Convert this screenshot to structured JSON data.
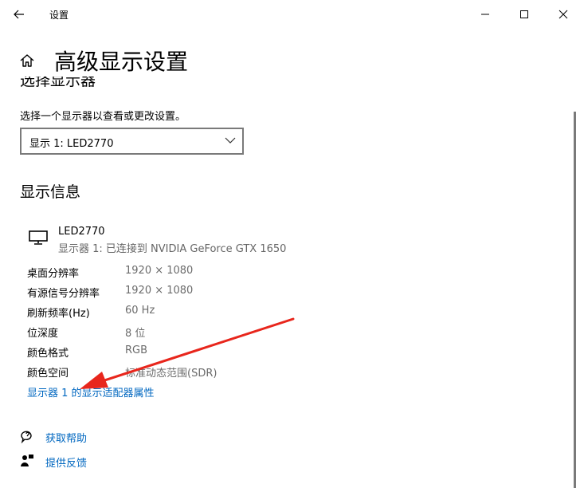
{
  "window": {
    "title": "设置",
    "controls": [
      "minimize-icon",
      "maximize-icon",
      "close-icon"
    ]
  },
  "page": {
    "title": "高级显示设置",
    "partial_heading": "选择显示器",
    "choose_text": "选择一个显示器以查看或更改设置。",
    "display_select": {
      "value": "显示 1: LED2770"
    }
  },
  "display_info": {
    "heading": "显示信息",
    "monitor_name": "LED2770",
    "monitor_sub": "显示器 1: 已连接到 NVIDIA GeForce GTX 1650",
    "rows": [
      {
        "label": "桌面分辨率",
        "value": "1920 × 1080"
      },
      {
        "label": "有源信号分辨率",
        "value": "1920 × 1080"
      },
      {
        "label": "刷新频率(Hz)",
        "value": "60 Hz"
      },
      {
        "label": "位深度",
        "value": "8 位"
      },
      {
        "label": "颜色格式",
        "value": "RGB"
      },
      {
        "label": "颜色空间",
        "value": "标准动态范围(SDR)"
      }
    ],
    "adapter_link": "显示器 1 的显示适配器属性"
  },
  "help": {
    "get_help": "获取帮助",
    "feedback": "提供反馈"
  },
  "annotation": {
    "arrow_color": "#e8261c"
  }
}
